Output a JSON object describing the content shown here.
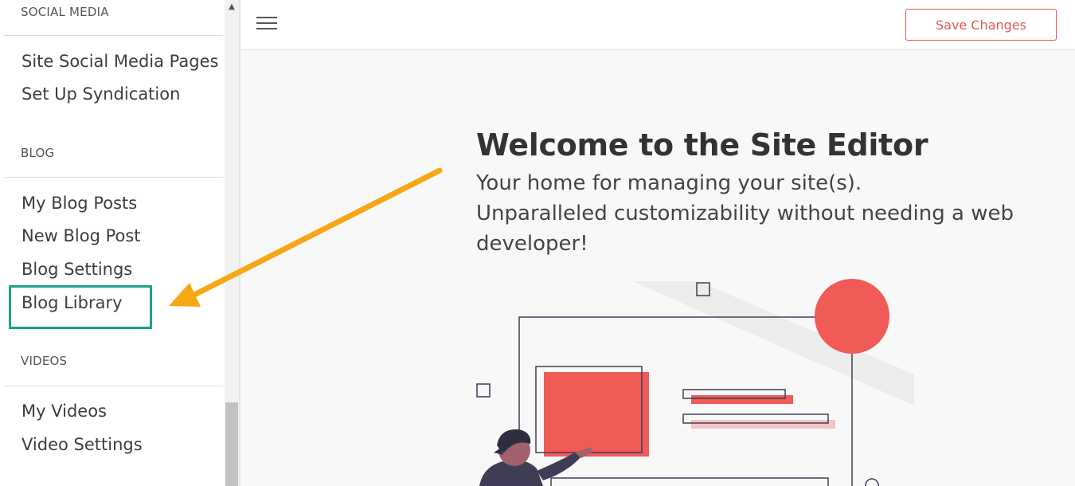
{
  "sidebar": {
    "sections": [
      {
        "heading": "SOCIAL MEDIA",
        "items": [
          "Site Social Media Pages",
          "Set Up Syndication"
        ]
      },
      {
        "heading": "BLOG",
        "items": [
          "My Blog Posts",
          "New Blog Post",
          "Blog Settings",
          "Blog Library"
        ]
      },
      {
        "heading": "VIDEOS",
        "items": [
          "My Videos",
          "Video Settings"
        ]
      }
    ],
    "highlighted_item": "Blog Library"
  },
  "topbar": {
    "menu_icon": "hamburger-icon",
    "save_label": "Save Changes"
  },
  "main": {
    "title": "Welcome to the Site Editor",
    "subtitle_lines": [
      "Your home for managing your site(s).",
      "Unparalleled customizability without needing a web",
      "developer!"
    ]
  },
  "colors": {
    "accent_red": "#e25a55",
    "illustration_red": "#f05a57",
    "highlight_green": "#1aa387",
    "arrow_orange": "#f5a716"
  }
}
